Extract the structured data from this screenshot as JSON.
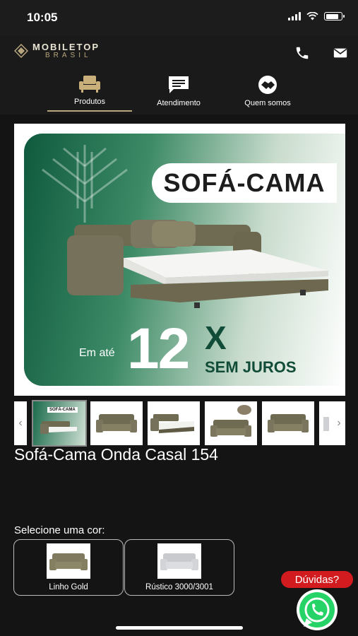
{
  "status": {
    "time": "10:05",
    "battery_level": 0.85
  },
  "header": {
    "brand_line1": "MOBILETOP",
    "brand_line2": "BRASIL",
    "phone_icon": "phone-icon",
    "mail_icon": "mail-icon"
  },
  "nav": {
    "items": [
      {
        "label": "Produtos",
        "icon": "armchair-icon",
        "active": true
      },
      {
        "label": "Atendimento",
        "icon": "chat-icon",
        "active": false
      },
      {
        "label": "Quem somos",
        "icon": "handshake-icon",
        "active": false
      }
    ]
  },
  "banner": {
    "title": "SOFÁ-CAMA",
    "prefix": "Em até",
    "installments": "12",
    "x": "X",
    "suffix": "SEM JUROS"
  },
  "thumbs": {
    "first_title": "SOFÁ-CAMA",
    "prev": "‹",
    "next": "›"
  },
  "product": {
    "title": "Sofá-Cama Onda Casal 154"
  },
  "colors": {
    "label": "Selecione uma cor:",
    "options": [
      {
        "label": "Linho Gold",
        "swatch": "#7f7a5f"
      },
      {
        "label": "Rústico 3000/3001",
        "swatch": "#d7d8db"
      }
    ]
  },
  "help": {
    "label": "Dúvidas?"
  },
  "theme": {
    "accent_green": "#16614a",
    "gold": "#b8a77c",
    "help_red": "#d21b1f",
    "whatsapp_green": "#25d366"
  }
}
